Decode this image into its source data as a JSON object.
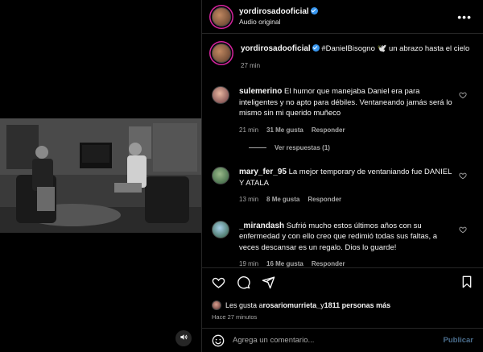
{
  "header": {
    "username": "yordirosadooficial",
    "subtitle": "Audio original",
    "more_label": "•••"
  },
  "caption": {
    "username": "yordirosadooficial",
    "text": " #DanielBisogno 🕊️ un abrazo hasta el cielo",
    "time": "27 min"
  },
  "comments": [
    {
      "username": "sulemerino",
      "text": " El humor que manejaba Daniel era para inteligentes y no apto para débiles. Ventaneando jamás será lo mismo sin mi querido muñeco",
      "time": "21 min",
      "likes": "31 Me gusta",
      "reply": "Responder",
      "view_replies": "Ver respuestas (1)"
    },
    {
      "username": "mary_fer_95",
      "text": " La mejor temporary de ventaniando fue DANIEL Y ATALA",
      "time": "13 min",
      "likes": "8 Me gusta",
      "reply": "Responder"
    },
    {
      "username": "_mirandash",
      "text": " Sufrió mucho estos últimos años con su enfermedad y con ello creo que redimió todas sus faltas, a veces descansar es un regalo. Dios lo guarde!",
      "time": "19 min",
      "likes": "16 Me gusta",
      "reply": "Responder"
    }
  ],
  "likes": {
    "prefix": "Les gusta a ",
    "user": "rosariomurrieta_",
    "middle": " y ",
    "count": "1811 personas más",
    "time_ago": "Hace 27 minutos"
  },
  "add_comment": {
    "placeholder": "Agrega un comentario...",
    "publish": "Publicar"
  },
  "colors": {
    "background": "#000000",
    "verified": "#3897f0",
    "muted_text": "#a8a8a8",
    "publish_disabled": "#4a6d8c"
  },
  "icons": [
    "volume-icon",
    "verified-icon",
    "more-icon",
    "heart-icon",
    "comment-icon",
    "share-icon",
    "bookmark-icon",
    "emoji-icon"
  ]
}
